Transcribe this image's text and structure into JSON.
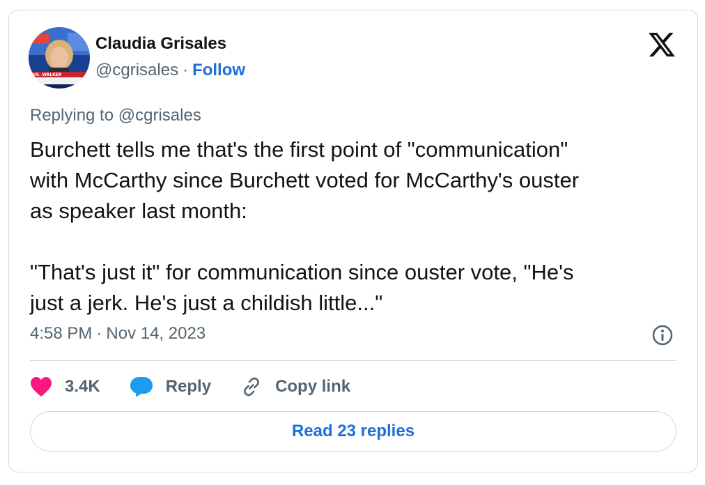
{
  "author": {
    "name": "Claudia Grisales",
    "handle": "@cgrisales",
    "separator": "·",
    "follow_label": "Follow",
    "avatar_caption": "VS. WALKER"
  },
  "brand": {
    "logo_icon": "x-logo-icon"
  },
  "tweet": {
    "replying_prefix": "Replying to",
    "replying_to": "@cgrisales",
    "text": "Burchett tells me that's the first point of \"communication\"\nwith McCarthy since Burchett voted for McCarthy's ouster\nas speaker last month:\n\n\"That's just it\" for communication since ouster vote, \"He's\njust a jerk. He's just a childish little...\"",
    "time": "4:58 PM",
    "separator": "·",
    "date": "Nov 14, 2023"
  },
  "actions": {
    "likes": "3.4K",
    "reply_label": "Reply",
    "copy_label": "Copy link"
  },
  "read_replies_label": "Read 23 replies",
  "colors": {
    "link": "#1d6fd8",
    "heart": "#f91880",
    "reply_bubble": "#1d9bf0",
    "muted": "#536471"
  }
}
